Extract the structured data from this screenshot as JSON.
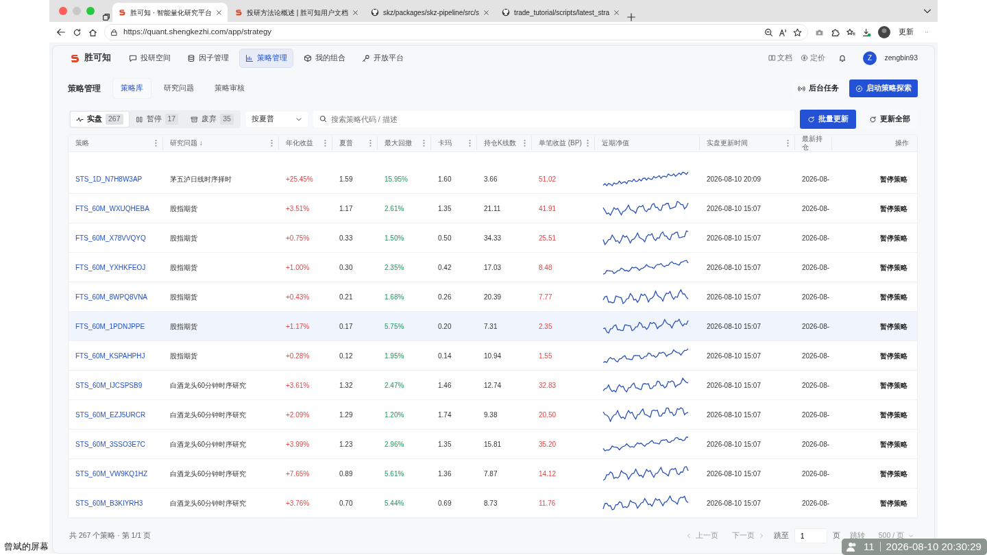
{
  "browser": {
    "tabs": [
      {
        "title": "胜可知 · 智能量化研究平台",
        "selected": true
      },
      {
        "title": "投研方法论概述 | 胜可知用户文档",
        "selected": false
      },
      {
        "title": "skz/packages/skz-pipeline/src/s",
        "selected": false
      },
      {
        "title": "trade_tutorial/scripts/latest_stra",
        "selected": false
      }
    ],
    "url": "https://quant.shengkezhi.com/app/strategy",
    "update_button": "更新"
  },
  "app": {
    "brand": "胜可知",
    "nav": [
      {
        "label": "投研空间",
        "selected": false
      },
      {
        "label": "因子管理",
        "selected": false
      },
      {
        "label": "策略管理",
        "selected": true
      },
      {
        "label": "我的组合",
        "selected": false
      },
      {
        "label": "开放平台",
        "selected": false
      }
    ],
    "header_links": [
      {
        "label": "文档"
      },
      {
        "label": "定价"
      }
    ],
    "user": {
      "initial": "Z",
      "name": "zengbin93"
    }
  },
  "page": {
    "title": "策略管理",
    "tabs": [
      {
        "label": "策略库",
        "selected": true
      },
      {
        "label": "研究问题",
        "selected": false
      },
      {
        "label": "策略审核",
        "selected": false
      }
    ],
    "actions": [
      {
        "label": "后台任务",
        "kind": "plain"
      },
      {
        "label": "启动策略探索",
        "kind": "primary"
      }
    ]
  },
  "filters": {
    "segments": [
      {
        "label": "实盘",
        "count": "267",
        "selected": true
      },
      {
        "label": "暂停",
        "count": "17",
        "selected": false
      },
      {
        "label": "废弃",
        "count": "35",
        "selected": false
      }
    ],
    "sort_select": "按夏普",
    "search": {
      "placeholder": "搜索策略代码 / 描述"
    },
    "buttons": [
      {
        "label": "批量更新",
        "kind": "primary"
      },
      {
        "label": "更新全部",
        "kind": "plain"
      }
    ]
  },
  "table": {
    "columns": [
      {
        "kind": "link",
        "label": "策略",
        "menu": true
      },
      {
        "kind": "text",
        "label": "研究问题 ↓",
        "menu": true
      },
      {
        "kind": "gain",
        "label": "年化收益",
        "menu": true
      },
      {
        "kind": "text",
        "label": "夏普",
        "menu": true
      },
      {
        "kind": "loss",
        "label": "最大回撤",
        "menu": true
      },
      {
        "kind": "text",
        "label": "卡玛",
        "menu": true
      },
      {
        "kind": "text",
        "label": "持仓K线数",
        "menu": true
      },
      {
        "kind": "gain",
        "label": "单笔收益 (BP)",
        "menu": true
      },
      {
        "kind": "chart",
        "label": "近期净值",
        "menu": false
      },
      {
        "kind": "text",
        "label": "实盘更新时间",
        "menu": true
      },
      {
        "kind": "text",
        "label": "最新持仓",
        "menu": false
      },
      {
        "kind": "action",
        "label": "操作",
        "menu": false
      }
    ],
    "rows": [
      {
        "highlighted": false,
        "cells": [
          "STS_1D_N7H8W3AP",
          "茅五泸日线时序择时",
          "+25.45%",
          "1.59",
          "15.95%",
          "1.60",
          "3.66",
          "51.02",
          "",
          "2026-08-10 20:09",
          "2026-08-",
          "暂停策略"
        ]
      },
      {
        "highlighted": false,
        "cells": [
          "FTS_60M_WXUQHEBA",
          "股指期货",
          "+3.51%",
          "1.17",
          "2.61%",
          "1.35",
          "21.11",
          "41.91",
          "",
          "2026-08-10 15:07",
          "2026-08-",
          "暂停策略"
        ]
      },
      {
        "highlighted": false,
        "cells": [
          "FTS_60M_X78VVQYQ",
          "股指期货",
          "+0.75%",
          "0.33",
          "1.50%",
          "0.50",
          "34.33",
          "25.51",
          "",
          "2026-08-10 15:07",
          "2026-08-",
          "暂停策略"
        ]
      },
      {
        "highlighted": false,
        "cells": [
          "FTS_60M_YXHKFEOJ",
          "股指期货",
          "+1.00%",
          "0.30",
          "2.35%",
          "0.42",
          "17.03",
          "8.48",
          "",
          "2026-08-10 15:07",
          "2026-08-",
          "暂停策略"
        ]
      },
      {
        "highlighted": false,
        "cells": [
          "FTS_60M_8WPQ8VNA",
          "股指期货",
          "+0.43%",
          "0.21",
          "1.68%",
          "0.26",
          "20.39",
          "7.77",
          "",
          "2026-08-10 15:07",
          "2026-08-",
          "暂停策略"
        ]
      },
      {
        "highlighted": true,
        "cells": [
          "FTS_60M_1PDNJPPE",
          "股指期货",
          "+1.17%",
          "0.17",
          "5.75%",
          "0.20",
          "7.31",
          "2.35",
          "",
          "2026-08-10 15:07",
          "2026-08-",
          "暂停策略"
        ]
      },
      {
        "highlighted": false,
        "cells": [
          "FTS_60M_KSPAHPHJ",
          "股指期货",
          "+0.28%",
          "0.12",
          "1.95%",
          "0.14",
          "10.94",
          "1.55",
          "",
          "2026-08-10 15:07",
          "2026-08-",
          "暂停策略"
        ]
      },
      {
        "highlighted": false,
        "cells": [
          "STS_60M_IJCSPSB9",
          "白酒龙头60分钟时序研究",
          "+3.61%",
          "1.32",
          "2.47%",
          "1.46",
          "12.74",
          "32.83",
          "",
          "2026-08-10 15:07",
          "2026-08-",
          "暂停策略"
        ]
      },
      {
        "highlighted": false,
        "cells": [
          "STS_60M_EZJ5URCR",
          "白酒龙头60分钟时序研究",
          "+2.09%",
          "1.29",
          "1.20%",
          "1.74",
          "9.38",
          "20.50",
          "",
          "2026-08-10 15:07",
          "2026-08-",
          "暂停策略"
        ]
      },
      {
        "highlighted": false,
        "cells": [
          "STS_60M_3SSO3E7C",
          "白酒龙头60分钟时序研究",
          "+3.99%",
          "1.23",
          "2.96%",
          "1.35",
          "15.81",
          "35.20",
          "",
          "2026-08-10 15:07",
          "2026-08-",
          "暂停策略"
        ]
      },
      {
        "highlighted": false,
        "cells": [
          "STS_60M_VW9KQ1HZ",
          "白酒龙头60分钟时序研究",
          "+7.65%",
          "0.89",
          "5.61%",
          "1.36",
          "7.87",
          "14.12",
          "",
          "2026-08-10 15:07",
          "2026-08-",
          "暂停策略"
        ]
      },
      {
        "highlighted": false,
        "cells": [
          "STS_60M_B3KIYRH3",
          "白酒龙头60分钟时序研究",
          "+3.76%",
          "0.70",
          "5.44%",
          "0.69",
          "8.73",
          "11.76",
          "",
          "2026-08-10 15:07",
          "2026-08-",
          "暂停策略"
        ]
      }
    ]
  },
  "footer": {
    "summary": "共 267 个策略 · 第 1/1 页",
    "prev": "上一页",
    "next": "下一页",
    "jump_label": "跳至",
    "page_input": "1",
    "page_unit": "页",
    "jump": "跳转",
    "page_size": "500 / 页"
  },
  "screen_share": {
    "owner": "曾斌的屏幕",
    "viewers": "11",
    "time": "2026-08-10 20:30:29"
  }
}
